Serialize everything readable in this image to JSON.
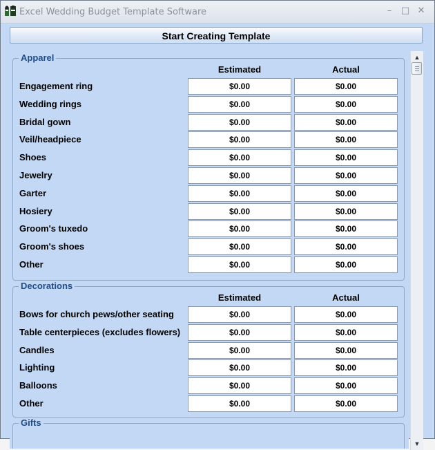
{
  "window": {
    "title": "Excel Wedding Budget Template Software",
    "minimize_glyph": "–",
    "maximize_glyph": "□",
    "close_glyph": "✕"
  },
  "start_button": {
    "label": "Start Creating Template"
  },
  "sections": [
    {
      "title": "Apparel",
      "estimated_header": "Estimated",
      "actual_header": "Actual",
      "rows": [
        {
          "label": "Engagement ring",
          "estimated": "$0.00",
          "actual": "$0.00"
        },
        {
          "label": "Wedding rings",
          "estimated": "$0.00",
          "actual": "$0.00"
        },
        {
          "label": "Bridal gown",
          "estimated": "$0.00",
          "actual": "$0.00"
        },
        {
          "label": "Veil/headpiece",
          "estimated": "$0.00",
          "actual": "$0.00"
        },
        {
          "label": "Shoes",
          "estimated": "$0.00",
          "actual": "$0.00"
        },
        {
          "label": "Jewelry",
          "estimated": "$0.00",
          "actual": "$0.00"
        },
        {
          "label": "Garter",
          "estimated": "$0.00",
          "actual": "$0.00"
        },
        {
          "label": "Hosiery",
          "estimated": "$0.00",
          "actual": "$0.00"
        },
        {
          "label": "Groom's tuxedo",
          "estimated": "$0.00",
          "actual": "$0.00"
        },
        {
          "label": "Groom's shoes",
          "estimated": "$0.00",
          "actual": "$0.00"
        },
        {
          "label": "Other",
          "estimated": "$0.00",
          "actual": "$0.00"
        }
      ]
    },
    {
      "title": "Decorations",
      "estimated_header": "Estimated",
      "actual_header": "Actual",
      "rows": [
        {
          "label": "Bows for church pews/other seating",
          "estimated": "$0.00",
          "actual": "$0.00"
        },
        {
          "label": "Table centerpieces (excludes flowers)",
          "estimated": "$0.00",
          "actual": "$0.00"
        },
        {
          "label": "Candles",
          "estimated": "$0.00",
          "actual": "$0.00"
        },
        {
          "label": "Lighting",
          "estimated": "$0.00",
          "actual": "$0.00"
        },
        {
          "label": "Balloons",
          "estimated": "$0.00",
          "actual": "$0.00"
        },
        {
          "label": "Other",
          "estimated": "$0.00",
          "actual": "$0.00"
        }
      ]
    },
    {
      "title": "Gifts"
    }
  ],
  "scrollbar": {
    "up_glyph": "▲",
    "down_glyph": "▼"
  }
}
